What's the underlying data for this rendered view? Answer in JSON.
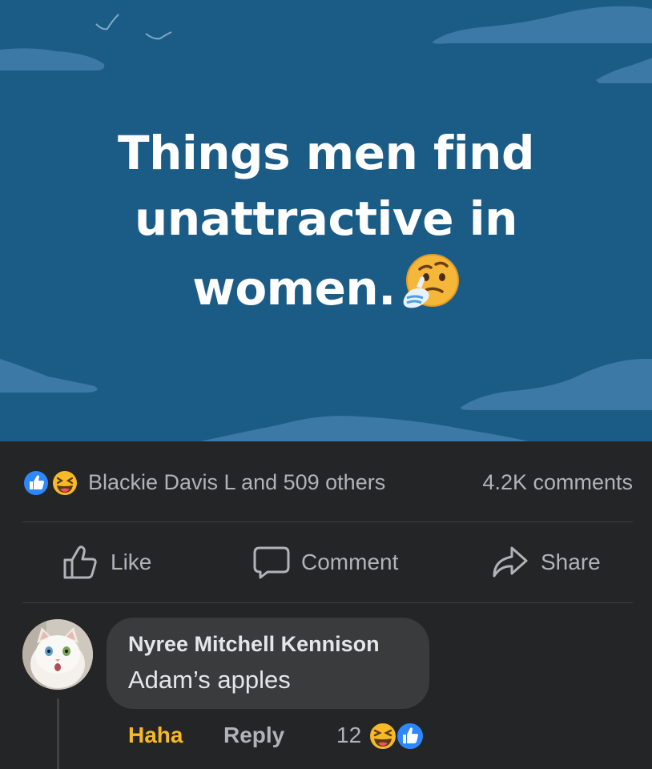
{
  "post": {
    "text_lines": [
      "Things men find",
      "unattractive in",
      "women."
    ],
    "emoji": "thinking-face",
    "background_color": "#1b5c86"
  },
  "reactions": {
    "icons": [
      "like-icon",
      "haha-icon"
    ],
    "names": "Blackie Davis L and 509 others",
    "comments": "4.2K comments"
  },
  "actions": {
    "like": "Like",
    "comment": "Comment",
    "share": "Share"
  },
  "comment": {
    "author": "Nyree Mitchell Kennison",
    "text": "Adam’s apples",
    "reaction_label": "Haha",
    "reply_label": "Reply",
    "reaction_count": "12",
    "reaction_icons": [
      "haha-icon",
      "like-icon"
    ],
    "reaction_label_color": "#f7b928"
  }
}
